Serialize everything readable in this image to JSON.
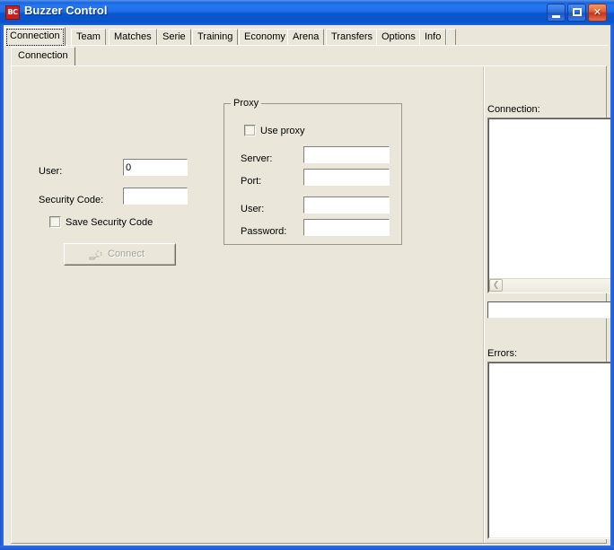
{
  "window": {
    "title": "Buzzer Control",
    "icon_label": "BC",
    "icon_name": "app-icon-bc",
    "controls": {
      "minimize": "Minimize",
      "maximize": "Maximize",
      "close": "Close"
    }
  },
  "main_tabs": [
    {
      "label": "Connection",
      "selected": true
    },
    {
      "label": "Team",
      "selected": false
    },
    {
      "label": "Matches",
      "selected": false
    },
    {
      "label": "Serie",
      "selected": false
    },
    {
      "label": "Training",
      "selected": false
    },
    {
      "label": "Economy",
      "selected": false
    },
    {
      "label": "Arena",
      "selected": false
    },
    {
      "label": "Transfers",
      "selected": false
    },
    {
      "label": "Options",
      "selected": false
    },
    {
      "label": "Info",
      "selected": false
    }
  ],
  "sub_tabs": [
    {
      "label": "Connection",
      "selected": true
    }
  ],
  "login": {
    "user_label": "User:",
    "user_value": "0",
    "user_placeholder": "",
    "security_code_label": "Security Code:",
    "security_code_value": "",
    "security_code_placeholder": "",
    "save_security_code_label": "Save Security Code",
    "save_security_code_checked": false,
    "connect_label": "Connect",
    "connect_enabled": false,
    "connect_icon": "plug-connect-icon"
  },
  "proxy": {
    "group_title": "Proxy",
    "use_proxy_label": "Use proxy",
    "use_proxy_checked": false,
    "server_label": "Server:",
    "server_value": "",
    "port_label": "Port:",
    "port_value": "",
    "user_label": "User:",
    "user_value": "",
    "password_label": "Password:",
    "password_value": ""
  },
  "status": {
    "connection_label": "Connection:",
    "connection_log": "",
    "connection_status_value": "",
    "errors_label": "Errors:",
    "errors_log": "",
    "scroll_left_icon": "chevron-left-icon"
  },
  "colors": {
    "titlebar_blue": "#0a56cf",
    "window_face": "#eae7da",
    "field_white": "#ffffff",
    "icon_red": "#c32222",
    "disabled_text": "#a4a198"
  }
}
